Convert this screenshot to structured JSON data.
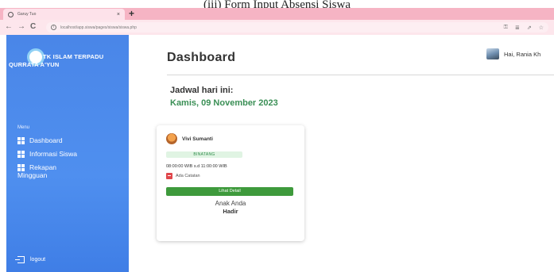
{
  "caption": "(iii) Form Input Absensi Siswa",
  "browser": {
    "tab_title": "Garuy Tuo",
    "tab_close": "×",
    "new_tab": "+",
    "url": "localhost/app.siswa/pages/siswa/siswa.php",
    "nav": {
      "back": "←",
      "forward": "→",
      "reload": "C"
    }
  },
  "sidebar": {
    "brand_line1": "TK ISLAM TERPADU",
    "brand_line2": "QURRATA A'YUN",
    "menu_heading": "Menu",
    "items": [
      {
        "label": "Dashboard"
      },
      {
        "label": "Informasi Siswa"
      },
      {
        "label_line1": "Rekapan",
        "label_line2": "Mingguan"
      }
    ],
    "logout_label": "logout"
  },
  "header": {
    "title": "Dashboard",
    "greeting": "Hai, Rania Kh"
  },
  "schedule": {
    "label": "Jadwal hari ini:",
    "date": "Kamis, 09 November 2023"
  },
  "card": {
    "student_name": "Vivi Sumanti",
    "status": "BINATANG",
    "time_range": "08:00:00 WIB s.d 11:00:00 WIB",
    "note": "Ada Catatan",
    "button_label": "Lihat Detail",
    "child_label": "Anak Anda",
    "child_status": "Hadir"
  },
  "colors": {
    "sidebar": "#4a86e8",
    "accent_green": "#3a8f55",
    "button_green": "#3e9a3c",
    "tabbar": "#f6b4c4"
  }
}
